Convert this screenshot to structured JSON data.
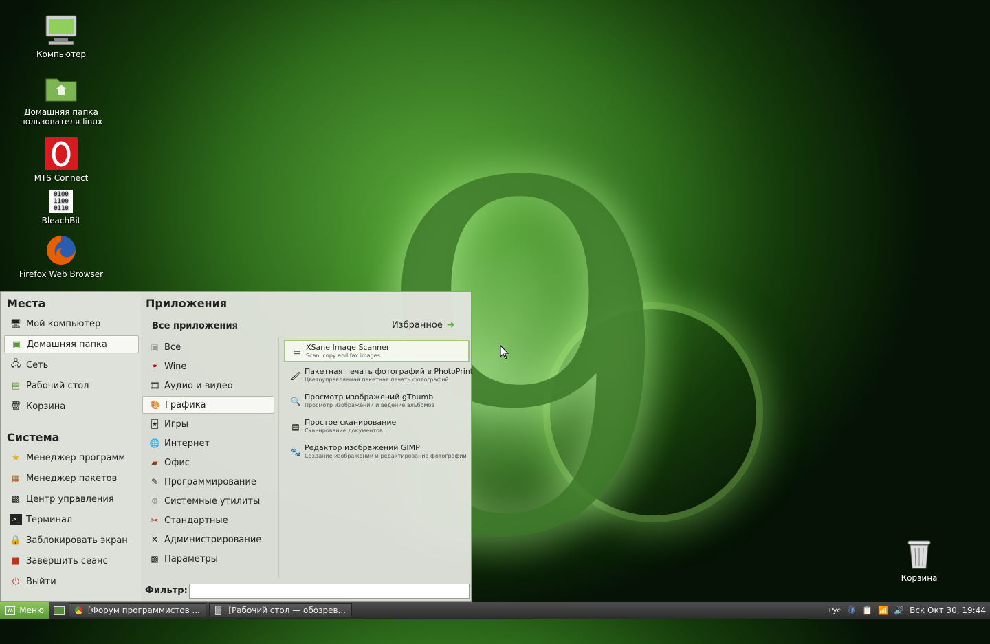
{
  "desktop": {
    "icons": [
      {
        "label": "Компьютер",
        "icon": "computer-icon"
      },
      {
        "label": "Домашняя папка\nпользователя linux",
        "icon": "home-folder-icon"
      },
      {
        "label": "MTS Connect",
        "icon": "mts-connect-icon"
      },
      {
        "label": "BleachBit",
        "icon": "bleachbit-icon"
      },
      {
        "label": "Firefox Web Browser",
        "icon": "firefox-icon"
      }
    ],
    "trash_label": "Корзина",
    "wallpaper_number": "9"
  },
  "menu": {
    "places_title": "Места",
    "places": [
      {
        "label": "Мой компьютер",
        "icon": "computer-icon"
      },
      {
        "label": "Домашняя папка",
        "icon": "home-folder-icon",
        "selected": true
      },
      {
        "label": "Сеть",
        "icon": "network-icon"
      },
      {
        "label": "Рабочий стол",
        "icon": "desktop-icon"
      },
      {
        "label": "Корзина",
        "icon": "trash-icon"
      }
    ],
    "system_title": "Система",
    "system": [
      {
        "label": "Менеджер программ",
        "icon": "star-icon"
      },
      {
        "label": "Менеджер пакетов",
        "icon": "package-icon"
      },
      {
        "label": "Центр управления",
        "icon": "control-center-icon"
      },
      {
        "label": "Терминал",
        "icon": "terminal-icon"
      },
      {
        "label": "Заблокировать экран",
        "icon": "lock-icon"
      },
      {
        "label": "Завершить сеанс",
        "icon": "logout-icon"
      },
      {
        "label": "Выйти",
        "icon": "power-icon"
      }
    ],
    "apps_title": "Приложения",
    "all_apps_label": "Все приложения",
    "favorites_label": "Избранное",
    "categories": [
      {
        "label": "Все",
        "icon": "all-icon"
      },
      {
        "label": "Wine",
        "icon": "wine-icon"
      },
      {
        "label": "Аудио и видео",
        "icon": "multimedia-icon"
      },
      {
        "label": "Графика",
        "icon": "graphics-icon",
        "selected": true
      },
      {
        "label": "Игры",
        "icon": "games-icon"
      },
      {
        "label": "Интернет",
        "icon": "internet-icon"
      },
      {
        "label": "Офис",
        "icon": "office-icon"
      },
      {
        "label": "Программирование",
        "icon": "programming-icon"
      },
      {
        "label": "Системные утилиты",
        "icon": "system-tools-icon"
      },
      {
        "label": "Стандартные",
        "icon": "accessories-icon"
      },
      {
        "label": "Администрирование",
        "icon": "admin-icon"
      },
      {
        "label": "Параметры",
        "icon": "settings-icon"
      }
    ],
    "apps": [
      {
        "title": "XSane Image Scanner",
        "desc": "Scan, copy and fax images",
        "icon": "scanner-icon",
        "selected": true
      },
      {
        "title": "Пакетная печать фотографий в PhotoPrint",
        "desc": "Цветоуправляемая пакетная печать фотографий",
        "icon": "photoprint-icon"
      },
      {
        "title": "Просмотр изображений gThumb",
        "desc": "Просмотр изображений и ведение альбомов",
        "icon": "gthumb-icon"
      },
      {
        "title": "Простое сканирование",
        "desc": "Сканирование документов",
        "icon": "simple-scan-icon"
      },
      {
        "title": "Редактор изображений GIMP",
        "desc": "Создание изображений и редактирование фотографий",
        "icon": "gimp-icon"
      }
    ],
    "filter_label": "Фильтр:",
    "filter_value": ""
  },
  "taskbar": {
    "menu_label": "Меню",
    "windows": [
      {
        "label": "[Форум программистов ...",
        "icon": "chrome-icon"
      },
      {
        "label": "[Рабочий стол — обозрев...",
        "icon": "file-manager-icon"
      }
    ],
    "keyboard_layout": "Рус",
    "clock": "Вск Окт 30, 19:44"
  }
}
